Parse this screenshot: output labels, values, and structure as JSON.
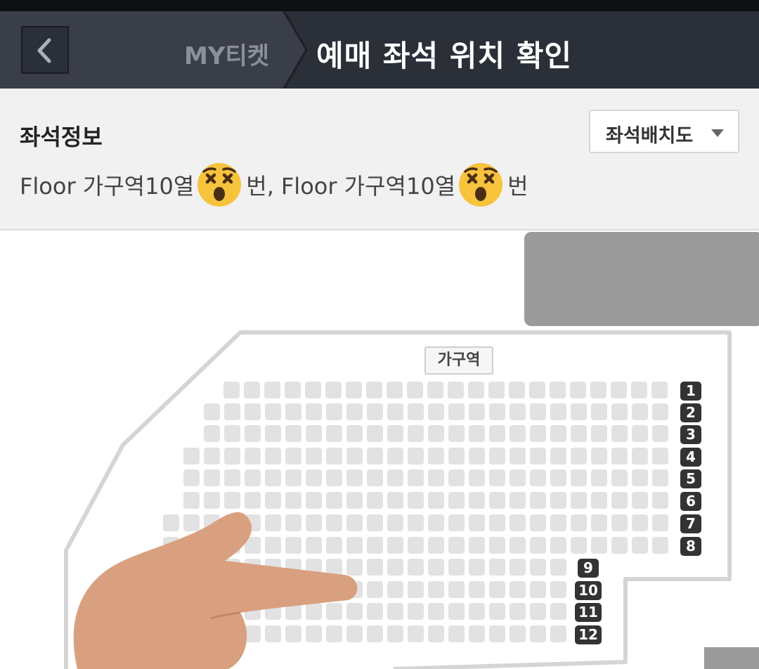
{
  "header": {
    "back_icon": "chevron-left-icon",
    "breadcrumb": "MY티켓",
    "title": "예매 좌석 위치 확인"
  },
  "seat_info": {
    "title": "좌석정보",
    "dropdown_label": "좌석배치도",
    "seat_1_prefix": "Floor 가구역10열",
    "seat_1_suffix": "번,",
    "seat_2_prefix": "Floor 가구역10열",
    "seat_2_suffix": "번",
    "emoji_icon": "dizzy-face-emoji"
  },
  "map": {
    "zone_label": "가구역",
    "rows": [
      "1",
      "2",
      "3",
      "4",
      "5",
      "6",
      "7",
      "8",
      "9",
      "10",
      "11",
      "12"
    ],
    "overlay_icon": "pointing-hand-icon",
    "colors": {
      "seat": "#e2e2e2",
      "row_badge": "#333333",
      "stage_block": "#9b9b9b",
      "hand": "#d9a07f"
    }
  }
}
